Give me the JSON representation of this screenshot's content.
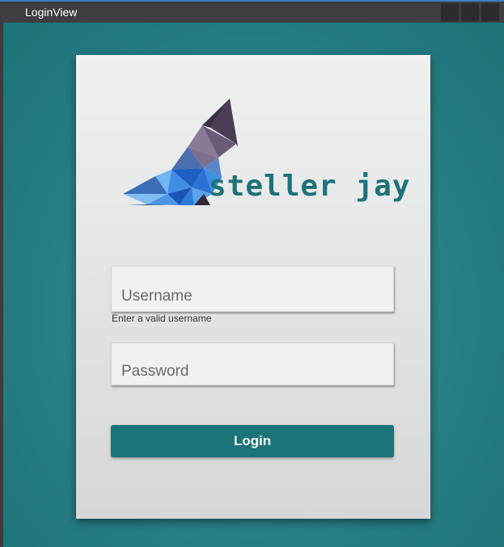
{
  "window": {
    "title": "LoginView",
    "controls": [
      "minimize-icon",
      "maximize-icon",
      "close-icon"
    ]
  },
  "logo": {
    "brand": "steller jay",
    "icon": "steller-jay-bird-icon"
  },
  "form": {
    "username_placeholder": "Username",
    "username_hint": "Enter a valid username",
    "password_placeholder": "Password",
    "login_label": "Login"
  },
  "colors": {
    "accent": "#1b7479",
    "background": "#2a8288",
    "card": "#eeefef"
  }
}
